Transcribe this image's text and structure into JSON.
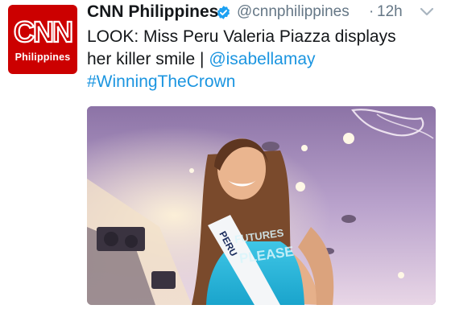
{
  "avatar": {
    "logo_text": "CNN",
    "sub_text": "Philippines",
    "color": "#cc0000"
  },
  "tweet": {
    "author_name": "CNN Philippines",
    "handle": "@cnnphilippines",
    "separator": "·",
    "time": "12h",
    "text_line1": "LOOK: Miss Peru Valeria Piazza displays",
    "text_line2_prefix": "her killer smile | ",
    "mention": "@isabellamay",
    "hashtag": "#WinningTheCrown",
    "link_color": "#1b95e0"
  },
  "media": {
    "sash_text_1": "PERU",
    "sash_text_2": "FUTURES",
    "sash_text_3": "PLEASE"
  },
  "icons": {
    "verified": "verified-badge-icon",
    "caret": "chevron-down-icon"
  }
}
